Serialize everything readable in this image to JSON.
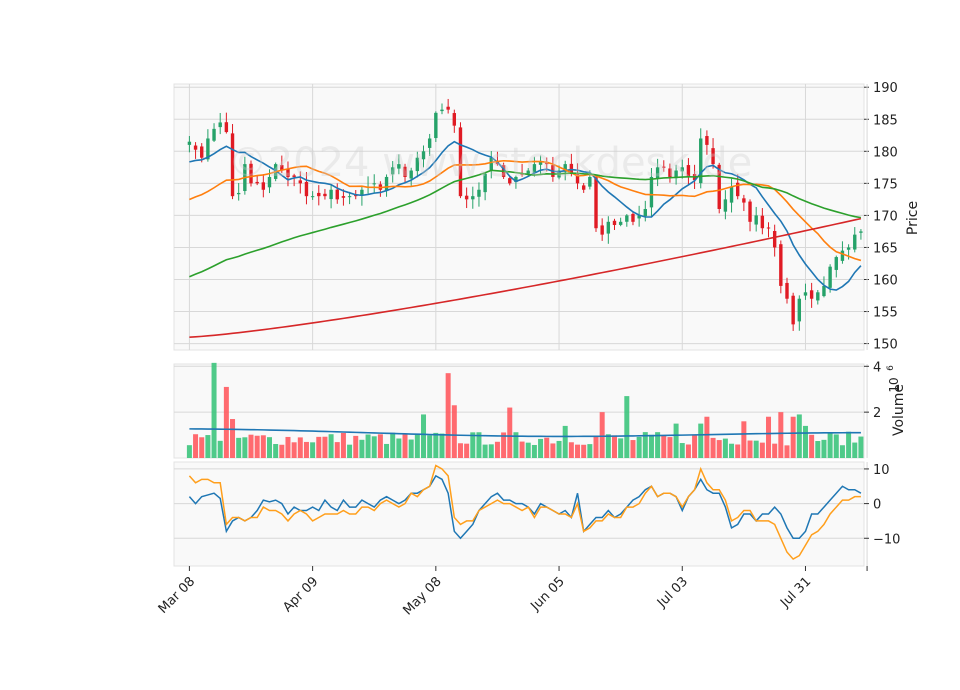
{
  "watermark": "©2024 www.stockdesk.de",
  "chart_data": [
    {
      "type": "candlestick",
      "panel": "price",
      "ylabel": "Price",
      "ylim": [
        149,
        190.5
      ],
      "yticks": [
        150,
        155,
        160,
        165,
        170,
        175,
        180,
        185,
        190
      ],
      "xlim": [
        -2.5,
        109.5
      ],
      "xtick_index": [
        0,
        20,
        40,
        60,
        80,
        100,
        110
      ],
      "xtick_labels": [
        "Mar 08",
        "Apr 09",
        "May 08",
        "Jun 05",
        "Jul 03",
        "Jul 31",
        ""
      ],
      "grid": true,
      "colors": {
        "up": "#26a269",
        "down": "#e01b24",
        "sma_short": "#1f77b4",
        "sma_mid": "#ff7f0e",
        "sma_long": "#2ca02c",
        "sma_200": "#d62728"
      },
      "anchors": [
        [
          0,
          181.5
        ],
        [
          2,
          179
        ],
        [
          3,
          182
        ],
        [
          4,
          183.5
        ],
        [
          5,
          184.5
        ],
        [
          6,
          183
        ],
        [
          7,
          173
        ],
        [
          8,
          173.5
        ],
        [
          9,
          178
        ],
        [
          10,
          175
        ],
        [
          11,
          175
        ],
        [
          12,
          174
        ],
        [
          13,
          176
        ],
        [
          14,
          178
        ],
        [
          15,
          177
        ],
        [
          16,
          176
        ],
        [
          17,
          176
        ],
        [
          18,
          175
        ],
        [
          19,
          173
        ],
        [
          20,
          173
        ],
        [
          22,
          173
        ],
        [
          23,
          174
        ],
        [
          24,
          172.5
        ],
        [
          26,
          173
        ],
        [
          27,
          173
        ],
        [
          28,
          174
        ],
        [
          29,
          174.5
        ],
        [
          30,
          175
        ],
        [
          31,
          174
        ],
        [
          32,
          176
        ],
        [
          33,
          177.5
        ],
        [
          34,
          178
        ],
        [
          35,
          176
        ],
        [
          36,
          177
        ],
        [
          37,
          179
        ],
        [
          38,
          180
        ],
        [
          39,
          182
        ],
        [
          40,
          186
        ],
        [
          41,
          186.5
        ],
        [
          42,
          186.5
        ],
        [
          43,
          184
        ],
        [
          44,
          173
        ],
        [
          45,
          172.5
        ],
        [
          46,
          173
        ],
        [
          47,
          174
        ],
        [
          48,
          176.5
        ],
        [
          49,
          179
        ],
        [
          50,
          178
        ],
        [
          51,
          176
        ],
        [
          52,
          175
        ],
        [
          53,
          176
        ],
        [
          54,
          176.5
        ],
        [
          55,
          177
        ],
        [
          56,
          178
        ],
        [
          57,
          178.5
        ],
        [
          58,
          178
        ],
        [
          59,
          176
        ],
        [
          60,
          177
        ],
        [
          61,
          178
        ],
        [
          62,
          176.5
        ],
        [
          63,
          175
        ],
        [
          64,
          174
        ],
        [
          65,
          176
        ],
        [
          66,
          168
        ],
        [
          67,
          167
        ],
        [
          68,
          169
        ],
        [
          69,
          168.5
        ],
        [
          70,
          169
        ],
        [
          71,
          170
        ],
        [
          72,
          169
        ],
        [
          73,
          170
        ],
        [
          74,
          171
        ],
        [
          75,
          176
        ],
        [
          76,
          177.5
        ],
        [
          77,
          177.5
        ],
        [
          78,
          176
        ],
        [
          79,
          177
        ],
        [
          80,
          177.5
        ],
        [
          81,
          176
        ],
        [
          82,
          175.5
        ],
        [
          83,
          182
        ],
        [
          84,
          181
        ],
        [
          85,
          178
        ],
        [
          86,
          171
        ],
        [
          87,
          172.5
        ],
        [
          88,
          174.5
        ],
        [
          89,
          173
        ],
        [
          90,
          172
        ],
        [
          91,
          169
        ],
        [
          92,
          170
        ],
        [
          93,
          168
        ],
        [
          94,
          168
        ],
        [
          95,
          165
        ],
        [
          96,
          159
        ],
        [
          97,
          157
        ],
        [
          98,
          153
        ],
        [
          99,
          157
        ],
        [
          100,
          158
        ],
        [
          101,
          157
        ],
        [
          102,
          158
        ],
        [
          103,
          159
        ],
        [
          104,
          162
        ],
        [
          105,
          163.5
        ],
        [
          106,
          164.5
        ],
        [
          107,
          165
        ],
        [
          108,
          167
        ],
        [
          109,
          167.5
        ]
      ],
      "sma_200_range": [
        151,
        169.5
      ]
    },
    {
      "type": "bar",
      "panel": "volume",
      "ylabel": "Volume",
      "unit": "10^6",
      "ylim": [
        0,
        4.1
      ],
      "yticks": [
        2,
        4
      ],
      "spike_index": [
        4,
        6,
        7,
        38,
        42,
        43,
        52,
        61,
        67,
        71,
        79,
        83,
        84,
        90,
        94,
        96,
        98,
        99,
        100
      ],
      "spike_value": [
        4.2,
        3.1,
        1.7,
        1.9,
        3.7,
        2.3,
        2.2,
        1.4,
        2.0,
        2.7,
        1.5,
        1.5,
        1.8,
        1.6,
        1.8,
        2.0,
        1.8,
        1.9,
        1.4
      ],
      "average_level": 1.15
    },
    {
      "type": "line",
      "panel": "oscillator",
      "ylim": [
        -18,
        12
      ],
      "yticks": [
        -10,
        0,
        10
      ],
      "series": [
        {
          "color": "#1f77b4",
          "values": [
            2,
            0,
            2,
            2.5,
            3,
            1.5,
            -8,
            -5,
            -4,
            -5,
            -4,
            -2,
            1,
            0.5,
            1,
            0,
            -3,
            -1,
            -2,
            -2,
            -1,
            -2,
            1,
            -1,
            -2,
            1,
            -1,
            -1,
            1,
            0,
            -1,
            1,
            2,
            1,
            0,
            1,
            3,
            3,
            4,
            5,
            8,
            7,
            3,
            -8,
            -10,
            -8,
            -6,
            -2,
            0,
            2,
            3,
            1,
            1,
            0,
            0,
            -1,
            -3,
            0,
            -1,
            -2,
            -3,
            -2,
            -4,
            3,
            -8,
            -6,
            -4,
            -4,
            -2,
            -4,
            -3,
            -1,
            1,
            2,
            4,
            5,
            2,
            3,
            3,
            2,
            -2,
            2,
            4,
            7,
            4,
            3,
            3,
            -1,
            -7,
            -6,
            -3,
            -3,
            -5,
            -3,
            -3,
            -1,
            -3,
            -7,
            -10,
            -10,
            -8,
            -3,
            -3,
            -1,
            1,
            3,
            5,
            4,
            4,
            3,
            2,
            3,
            4,
            4,
            2
          ]
        },
        {
          "color": "#ff9f1c",
          "values": [
            8,
            6,
            7,
            7,
            6,
            6,
            -6,
            -4,
            -4,
            -5,
            -4,
            -4,
            -1,
            -2,
            -2,
            -3,
            -5,
            -3,
            -2,
            -3,
            -5,
            -4,
            -3,
            -3,
            -3,
            -2,
            -3,
            -3,
            -1,
            -1,
            -2,
            0,
            1,
            0,
            -1,
            0,
            3,
            2,
            4,
            5,
            11,
            10,
            8,
            -4,
            -6,
            -5,
            -5,
            -2,
            -1,
            0,
            1,
            0,
            0,
            -1,
            -2,
            -1,
            -4,
            -1,
            -1,
            -2,
            -3,
            -3,
            -4,
            0,
            -8,
            -7,
            -5,
            -5,
            -3,
            -4,
            -4,
            -1,
            -1,
            0,
            3,
            5,
            2,
            3,
            3,
            2,
            -1,
            2,
            4,
            10,
            6,
            4,
            4,
            1,
            -5,
            -4,
            -2,
            -2,
            -5,
            -5,
            -5,
            -6,
            -10,
            -14,
            -16,
            -15,
            -12,
            -9,
            -8,
            -6,
            -3,
            -1,
            1,
            1,
            2,
            2,
            2,
            4,
            5,
            6,
            5
          ]
        }
      ]
    }
  ]
}
